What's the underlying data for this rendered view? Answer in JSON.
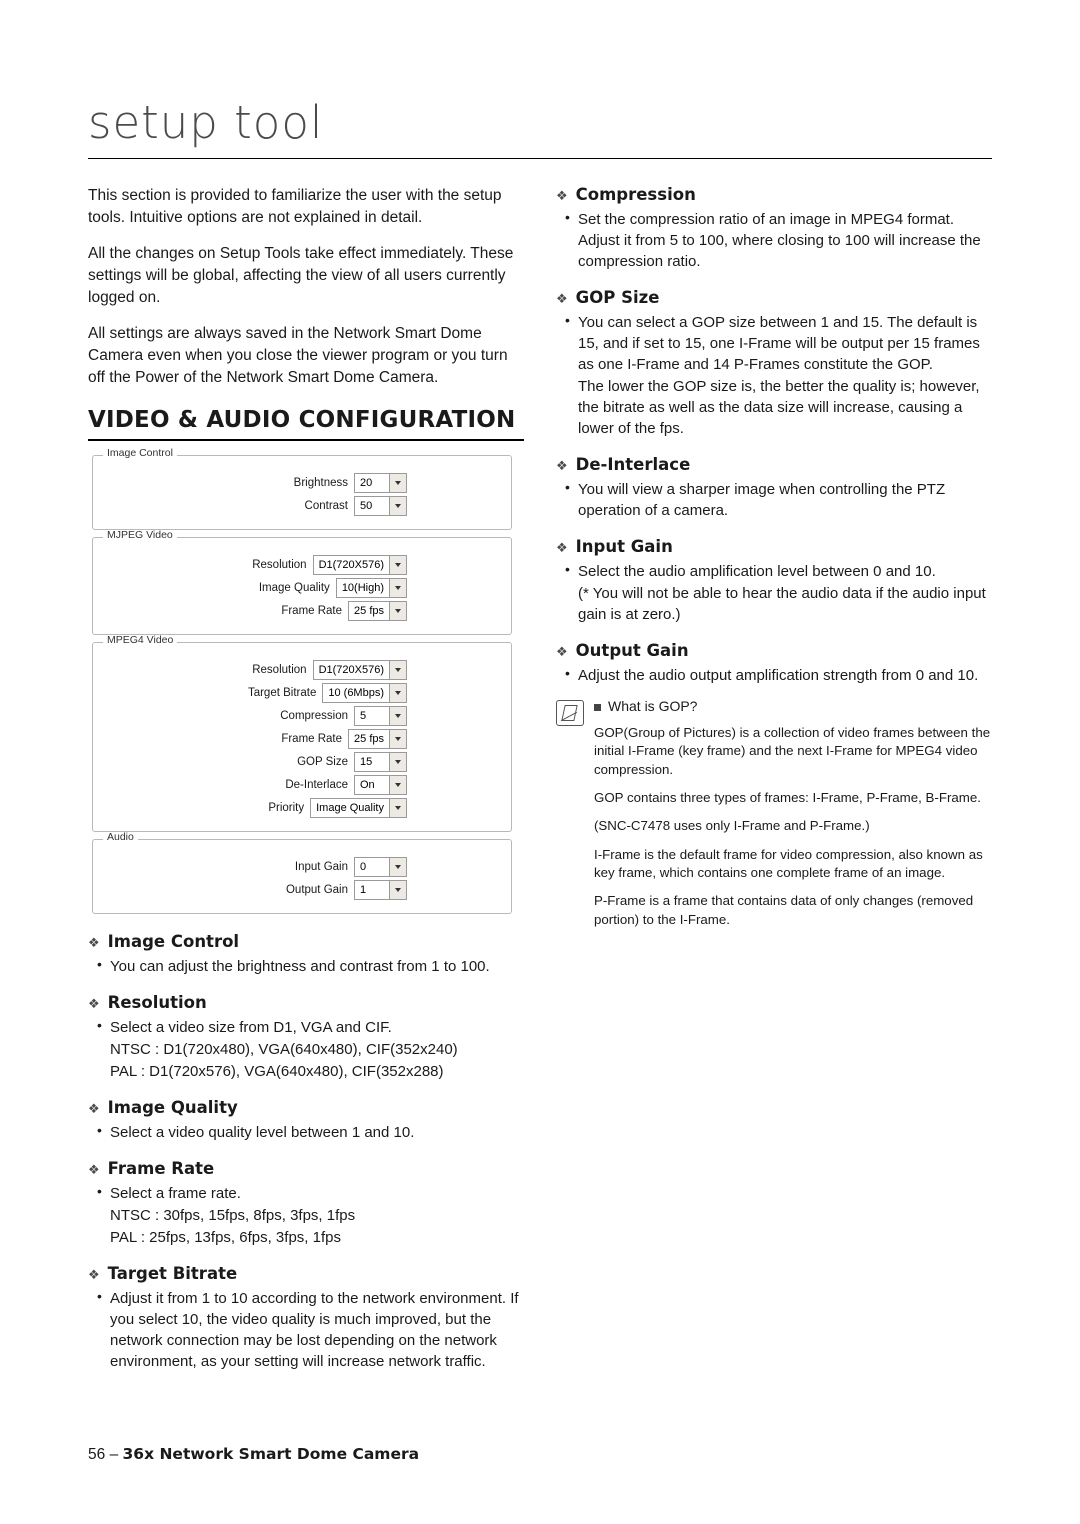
{
  "header": {
    "title": "setup tool"
  },
  "intro": {
    "p1": "This section is provided to familiarize the user with the setup tools. Intuitive options are not explained in detail.",
    "p2": "All the changes on Setup Tools take effect immediately. These settings will be global, affecting the view of all users currently logged on.",
    "p3": "All settings are always saved in the Network Smart Dome Camera even when you close the viewer program or you turn off the Power of the Network Smart Dome Camera."
  },
  "section": {
    "heading": "VIDEO & AUDIO CONFIGURATION"
  },
  "screenshot": {
    "groups": [
      {
        "legend": "Image Control",
        "rows": [
          {
            "label": "Brightness",
            "value": "20"
          },
          {
            "label": "Contrast",
            "value": "50"
          }
        ]
      },
      {
        "legend": "MJPEG Video",
        "rows": [
          {
            "label": "Resolution",
            "value": "D1(720X576)"
          },
          {
            "label": "Image Quality",
            "value": "10(High)"
          },
          {
            "label": "Frame Rate",
            "value": "25 fps"
          }
        ]
      },
      {
        "legend": "MPEG4 Video",
        "rows": [
          {
            "label": "Resolution",
            "value": "D1(720X576)"
          },
          {
            "label": "Target Bitrate",
            "value": "10 (6Mbps)"
          },
          {
            "label": "Compression",
            "value": "5"
          },
          {
            "label": "Frame Rate",
            "value": "25 fps"
          },
          {
            "label": "GOP Size",
            "value": "15"
          },
          {
            "label": "De-Interlace",
            "value": "On"
          },
          {
            "label": "Priority",
            "value": "Image Quality"
          }
        ]
      },
      {
        "legend": "Audio",
        "rows": [
          {
            "label": "Input Gain",
            "value": "0"
          },
          {
            "label": "Output Gain",
            "value": "1"
          }
        ]
      }
    ]
  },
  "left_topics": [
    {
      "title": "Image Control",
      "lines": [
        {
          "bullet": true,
          "text": "You can adjust the brightness and contrast from 1 to 100."
        }
      ]
    },
    {
      "title": "Resolution",
      "lines": [
        {
          "bullet": true,
          "text": "Select a video size from D1, VGA and CIF."
        },
        {
          "bullet": false,
          "text": "NTSC : D1(720x480), VGA(640x480), CIF(352x240)"
        },
        {
          "bullet": false,
          "text": "PAL : D1(720x576), VGA(640x480), CIF(352x288)"
        }
      ]
    },
    {
      "title": "Image Quality",
      "lines": [
        {
          "bullet": true,
          "text": "Select a video quality level between 1 and 10."
        }
      ]
    },
    {
      "title": "Frame Rate",
      "lines": [
        {
          "bullet": true,
          "text": "Select a frame rate."
        },
        {
          "bullet": false,
          "text": "NTSC : 30fps, 15fps, 8fps, 3fps, 1fps"
        },
        {
          "bullet": false,
          "text": "PAL : 25fps, 13fps, 6fps, 3fps, 1fps"
        }
      ]
    },
    {
      "title": "Target Bitrate",
      "lines": [
        {
          "bullet": true,
          "text": "Adjust it from 1 to 10 according to the network environment. If you select 10, the video quality is much improved, but the network connection may be lost depending on the network environment, as your setting will increase network traffic."
        }
      ]
    }
  ],
  "right_topics": [
    {
      "title": "Compression",
      "lines": [
        {
          "bullet": true,
          "text": "Set the compression ratio of an image in MPEG4 format. Adjust it from 5 to 100, where closing to 100 will increase the compression ratio."
        }
      ]
    },
    {
      "title": "GOP Size",
      "lines": [
        {
          "bullet": true,
          "text": "You can select a GOP size between 1 and 15. The default is 15, and if set to 15, one I-Frame will be output per 15 frames as one I-Frame and 14 P-Frames constitute the GOP."
        },
        {
          "bullet": false,
          "text": "The lower the GOP size is, the better the quality is; however, the bitrate as well as the data size will increase, causing a lower of the fps."
        }
      ]
    },
    {
      "title": "De-Interlace",
      "lines": [
        {
          "bullet": true,
          "text": "You will view a sharper image when controlling the PTZ operation of a camera."
        }
      ]
    },
    {
      "title": "Input Gain",
      "lines": [
        {
          "bullet": true,
          "text": "Select the audio amplification level between 0 and 10."
        },
        {
          "bullet": false,
          "text": "(* You will not be able to hear the audio data if the audio input gain is at zero.)"
        }
      ]
    },
    {
      "title": "Output Gain",
      "lines": [
        {
          "bullet": true,
          "text": "Adjust the audio output amplification strength from 0 and 10."
        }
      ]
    }
  ],
  "note": {
    "title": "What is GOP?",
    "paragraphs": [
      "GOP(Group of Pictures) is a collection of video frames between the initial I-Frame (key frame) and the next I-Frame for MPEG4 video compression.",
      "GOP contains three types of frames: I-Frame, P-Frame, B-Frame.",
      "(SNC-C7478 uses only I-Frame and P-Frame.)",
      "I-Frame is the default frame for video compression, also known as key frame, which contains one complete frame of an image.",
      "P-Frame is a frame that contains data of only changes (removed portion) to the I-Frame."
    ]
  },
  "footer": {
    "page": "56",
    "dash": "–",
    "name": "36x Network Smart Dome Camera"
  }
}
